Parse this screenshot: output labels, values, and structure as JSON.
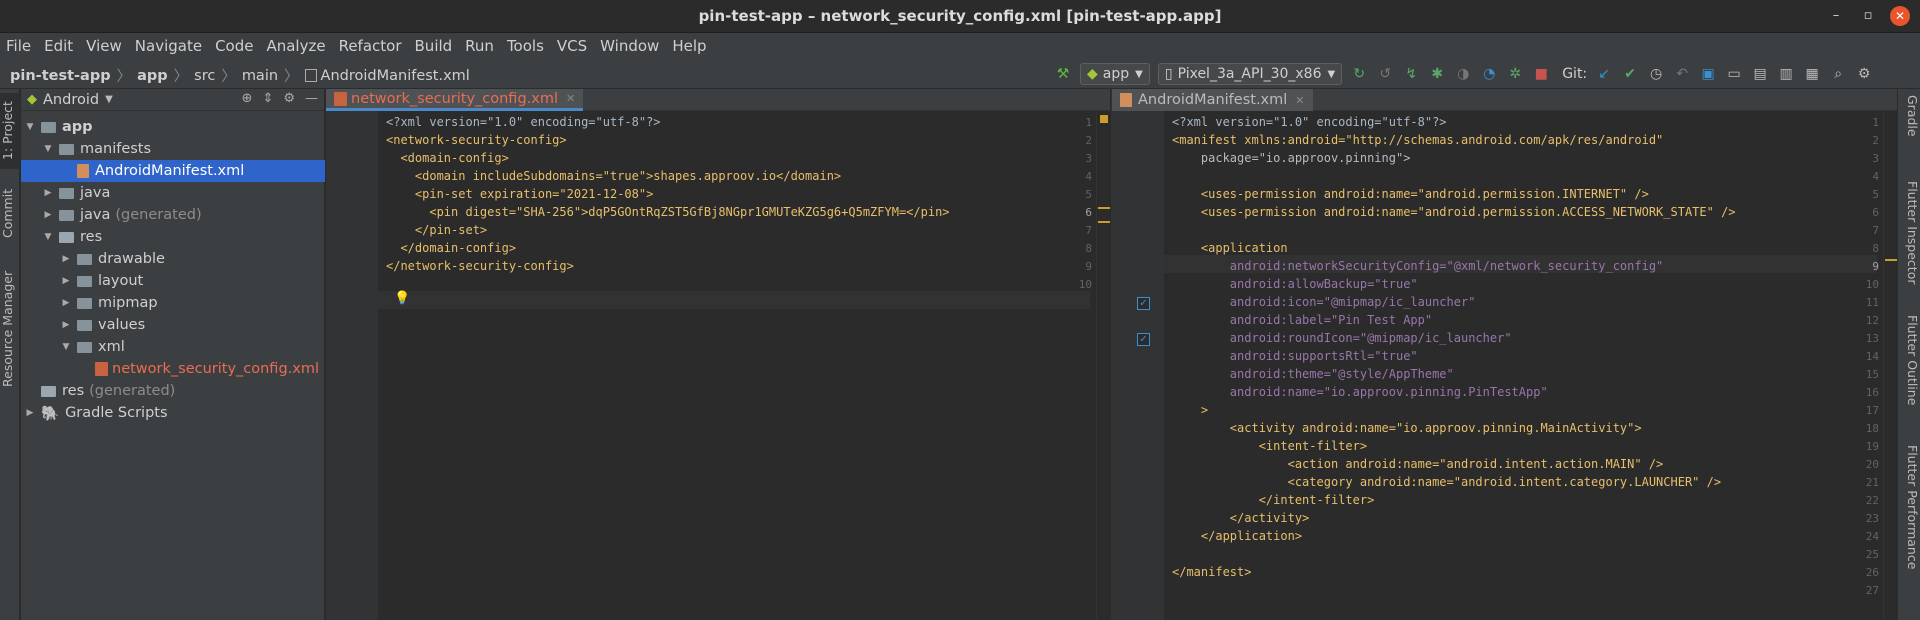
{
  "window": {
    "title": "pin-test-app – network_security_config.xml [pin-test-app.app]"
  },
  "menu": [
    "File",
    "Edit",
    "View",
    "Navigate",
    "Code",
    "Analyze",
    "Refactor",
    "Build",
    "Run",
    "Tools",
    "VCS",
    "Window",
    "Help"
  ],
  "breadcrumb": [
    "pin-test-app",
    "app",
    "src",
    "main",
    "AndroidManifest.xml"
  ],
  "toolbar": {
    "run_config": "app",
    "device": "Pixel_3a_API_30_x86",
    "git_label": "Git:"
  },
  "left_tabs": [
    "1: Project",
    "Commit",
    "Resource Manager"
  ],
  "right_tabs": [
    "Gradle",
    "Flutter Inspector",
    "Flutter Outline",
    "Flutter Performance"
  ],
  "project": {
    "view": "Android",
    "tree": [
      {
        "label": "app",
        "extra": ""
      },
      {
        "label": "manifests",
        "extra": ""
      },
      {
        "label": "AndroidManifest.xml",
        "extra": ""
      },
      {
        "label": "java",
        "extra": ""
      },
      {
        "label": "java",
        "extra": "(generated)"
      },
      {
        "label": "res",
        "extra": ""
      },
      {
        "label": "drawable",
        "extra": ""
      },
      {
        "label": "layout",
        "extra": ""
      },
      {
        "label": "mipmap",
        "extra": ""
      },
      {
        "label": "values",
        "extra": ""
      },
      {
        "label": "xml",
        "extra": ""
      },
      {
        "label": "network_security_config.xml",
        "extra": ""
      },
      {
        "label": "res",
        "extra": "(generated)"
      },
      {
        "label": "Gradle Scripts",
        "extra": ""
      }
    ]
  },
  "left_editor": {
    "tab": "network_security_config.xml",
    "lines": [
      "<?xml version=\"1.0\" encoding=\"utf-8\"?>",
      "<network-security-config>",
      "  <domain-config>",
      "    <domain includeSubdomains=\"true\">shapes.approov.io</domain>",
      "    <pin-set expiration=\"2021-12-08\">",
      "      <pin digest=\"SHA-256\">dqP5GOntRqZST5GfBj8NGpr1GMUTeKZG5g6+Q5mZFYM=</pin>",
      "    </pin-set>",
      "  </domain-config>",
      "</network-security-config>",
      ""
    ]
  },
  "right_editor": {
    "tab": "AndroidManifest.xml",
    "lines": [
      "<?xml version=\"1.0\" encoding=\"utf-8\"?>",
      "<manifest xmlns:android=\"http://schemas.android.com/apk/res/android\"",
      "    package=\"io.approov.pinning\">",
      "",
      "    <uses-permission android:name=\"android.permission.INTERNET\" />",
      "    <uses-permission android:name=\"android.permission.ACCESS_NETWORK_STATE\" />",
      "",
      "    <application",
      "        android:networkSecurityConfig=\"@xml/network_security_config\"",
      "        android:allowBackup=\"true\"",
      "        android:icon=\"@mipmap/ic_launcher\"",
      "        android:label=\"Pin Test App\"",
      "        android:roundIcon=\"@mipmap/ic_launcher\"",
      "        android:supportsRtl=\"true\"",
      "        android:theme=\"@style/AppTheme\"",
      "        android:name=\"io.approov.pinning.PinTestApp\"",
      "    >",
      "        <activity android:name=\"io.approov.pinning.MainActivity\">",
      "            <intent-filter>",
      "                <action android:name=\"android.intent.action.MAIN\" />",
      "                <category android:name=\"android.intent.category.LAUNCHER\" />",
      "            </intent-filter>",
      "        </activity>",
      "    </application>",
      "",
      "</manifest>",
      ""
    ]
  },
  "colors": {
    "accent": "#4a88c7",
    "selection": "#2f65ca",
    "tag": "#e8bf6a",
    "string": "#6a8759",
    "namespace": "#9876aa"
  }
}
